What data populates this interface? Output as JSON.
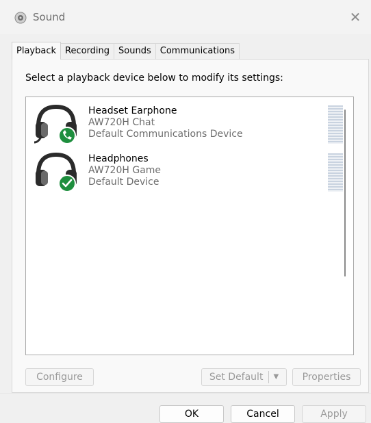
{
  "window": {
    "title": "Sound",
    "close_glyph": "✕"
  },
  "tabs": [
    {
      "label": "Playback",
      "active": true
    },
    {
      "label": "Recording"
    },
    {
      "label": "Sounds"
    },
    {
      "label": "Communications"
    }
  ],
  "instruction": "Select a playback device below to modify its settings:",
  "devices": [
    {
      "name": "Headset Earphone",
      "model": "AW720H Chat",
      "status": "Default Communications Device",
      "icon": "headset-phone-icon"
    },
    {
      "name": "Headphones",
      "model": "AW720H Game",
      "status": "Default Device",
      "icon": "headphones-check-icon"
    }
  ],
  "buttons": {
    "configure": "Configure",
    "set_default": "Set Default",
    "set_default_arrow": "▼",
    "properties": "Properties",
    "ok": "OK",
    "cancel": "Cancel",
    "apply": "Apply"
  },
  "colors": {
    "accent_green": "#1e8e3e",
    "headset_dark": "#2b2b2b"
  }
}
